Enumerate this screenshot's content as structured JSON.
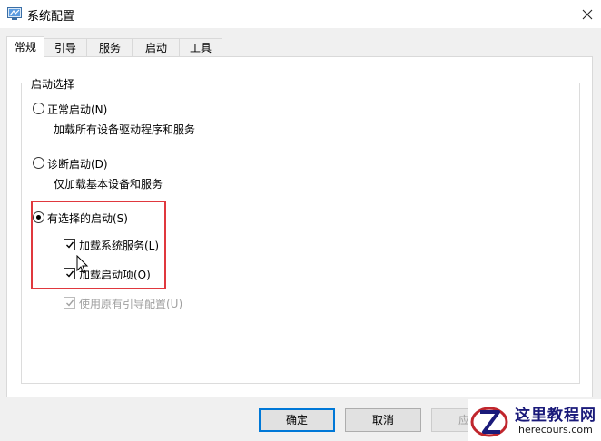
{
  "window": {
    "title": "系统配置"
  },
  "tabs": [
    {
      "label": "常规"
    },
    {
      "label": "引导"
    },
    {
      "label": "服务"
    },
    {
      "label": "启动"
    },
    {
      "label": "工具"
    }
  ],
  "startup_selection": {
    "group_title": "启动选择",
    "normal": {
      "label": "正常启动(N)",
      "description": "加载所有设备驱动程序和服务",
      "selected": false
    },
    "diagnostic": {
      "label": "诊断启动(D)",
      "description": "仅加载基本设备和服务",
      "selected": false
    },
    "selective": {
      "label": "有选择的启动(S)",
      "selected": true,
      "load_system_services": {
        "label": "加载系统服务(L)",
        "checked": true
      },
      "load_startup_items": {
        "label": "加载启动项(O)",
        "checked": true
      },
      "use_original_boot_config": {
        "label": "使用原有引导配置(U)",
        "checked": true,
        "enabled": false
      }
    }
  },
  "buttons": {
    "ok": "确定",
    "cancel": "取消",
    "apply": "应用"
  },
  "watermark": {
    "title": "这里教程网",
    "url": "herecours.com"
  },
  "colors": {
    "highlight": "#e0383e",
    "default_button_border": "#0078d7",
    "watermark_blue": "#1a1a7a"
  }
}
